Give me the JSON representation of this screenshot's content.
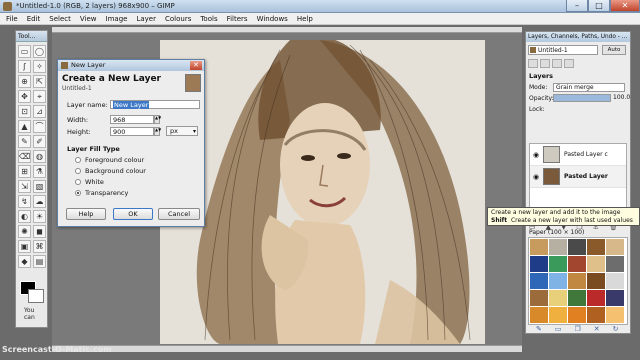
{
  "window": {
    "title": "*Untitled-1.0 (RGB, 2 layers) 968x900 – GIMP"
  },
  "menu": [
    "File",
    "Edit",
    "Select",
    "View",
    "Image",
    "Layer",
    "Colours",
    "Tools",
    "Filters",
    "Windows",
    "Help"
  ],
  "toolbox": {
    "title": "Tool...",
    "tools": [
      "▭",
      "◯",
      "ʃ",
      "✧",
      "⊕",
      "⇱",
      "✥",
      "⌖",
      "⊡",
      "⊿",
      "▲",
      "⌒",
      "✎",
      "✐",
      "⌫",
      "◍",
      "⊞",
      "⚗",
      "⇲",
      "▧",
      "↯",
      "☁",
      "◐",
      "☀",
      "✺",
      "◼",
      "▣",
      "⌘",
      "◆",
      "▤"
    ],
    "hint": "You can",
    "fg_color": "#000000",
    "bg_color": "#ffffff"
  },
  "dialog": {
    "title": "New Layer",
    "heading": "Create a New Layer",
    "subheading": "Untitled-1",
    "layer_name_label": "Layer name:",
    "layer_name_value": "New Layer",
    "width_label": "Width:",
    "width_value": "968",
    "height_label": "Height:",
    "height_value": "900",
    "unit": "px",
    "fill_type_label": "Layer Fill Type",
    "fill_options": [
      {
        "label": "Foreground colour",
        "selected": false
      },
      {
        "label": "Background colour",
        "selected": false
      },
      {
        "label": "White",
        "selected": false
      },
      {
        "label": "Transparency",
        "selected": true
      }
    ],
    "help_label": "Help",
    "ok_label": "OK",
    "cancel_label": "Cancel"
  },
  "dock": {
    "title": "Layers, Channels, Paths, Undo - ...",
    "image_select": "Untitled-1",
    "auto_label": "Auto",
    "layers_label": "Layers",
    "mode_label": "Mode:",
    "mode_value": "Grain merge",
    "opacity_label": "Opacity:",
    "opacity_value": "100.0",
    "opacity_fraction": 1.0,
    "lock_label": "Lock:",
    "layers": [
      {
        "name": "Pasted Layer c",
        "active": false
      },
      {
        "name": "Pasted Layer",
        "active": true
      }
    ],
    "patterns_label": "Paper (100 × 100)"
  },
  "tooltip": {
    "line1": "Create a new layer and add it to the image",
    "line2_key": "Shift",
    "line2_text": "Create a new layer with last used values"
  },
  "watermark": "Screencast-O-Matic.com",
  "pattern_colors": [
    "#c79a5e",
    "#b5b0a2",
    "#4a4a4a",
    "#8a5a2a",
    "#d7b88b",
    "#1f3c88",
    "#3a9a5c",
    "#a3462f",
    "#e0c08a",
    "#6d6d6d",
    "#2e66b8",
    "#7fb3e6",
    "#c08840",
    "#7a4a20",
    "#d9d9d9",
    "#9c6b3c",
    "#e8d07a",
    "#40783c",
    "#ba2a2a",
    "#3a3a6a",
    "#d88a2a",
    "#f0b040",
    "#e08020",
    "#b06020",
    "#f5c070"
  ]
}
